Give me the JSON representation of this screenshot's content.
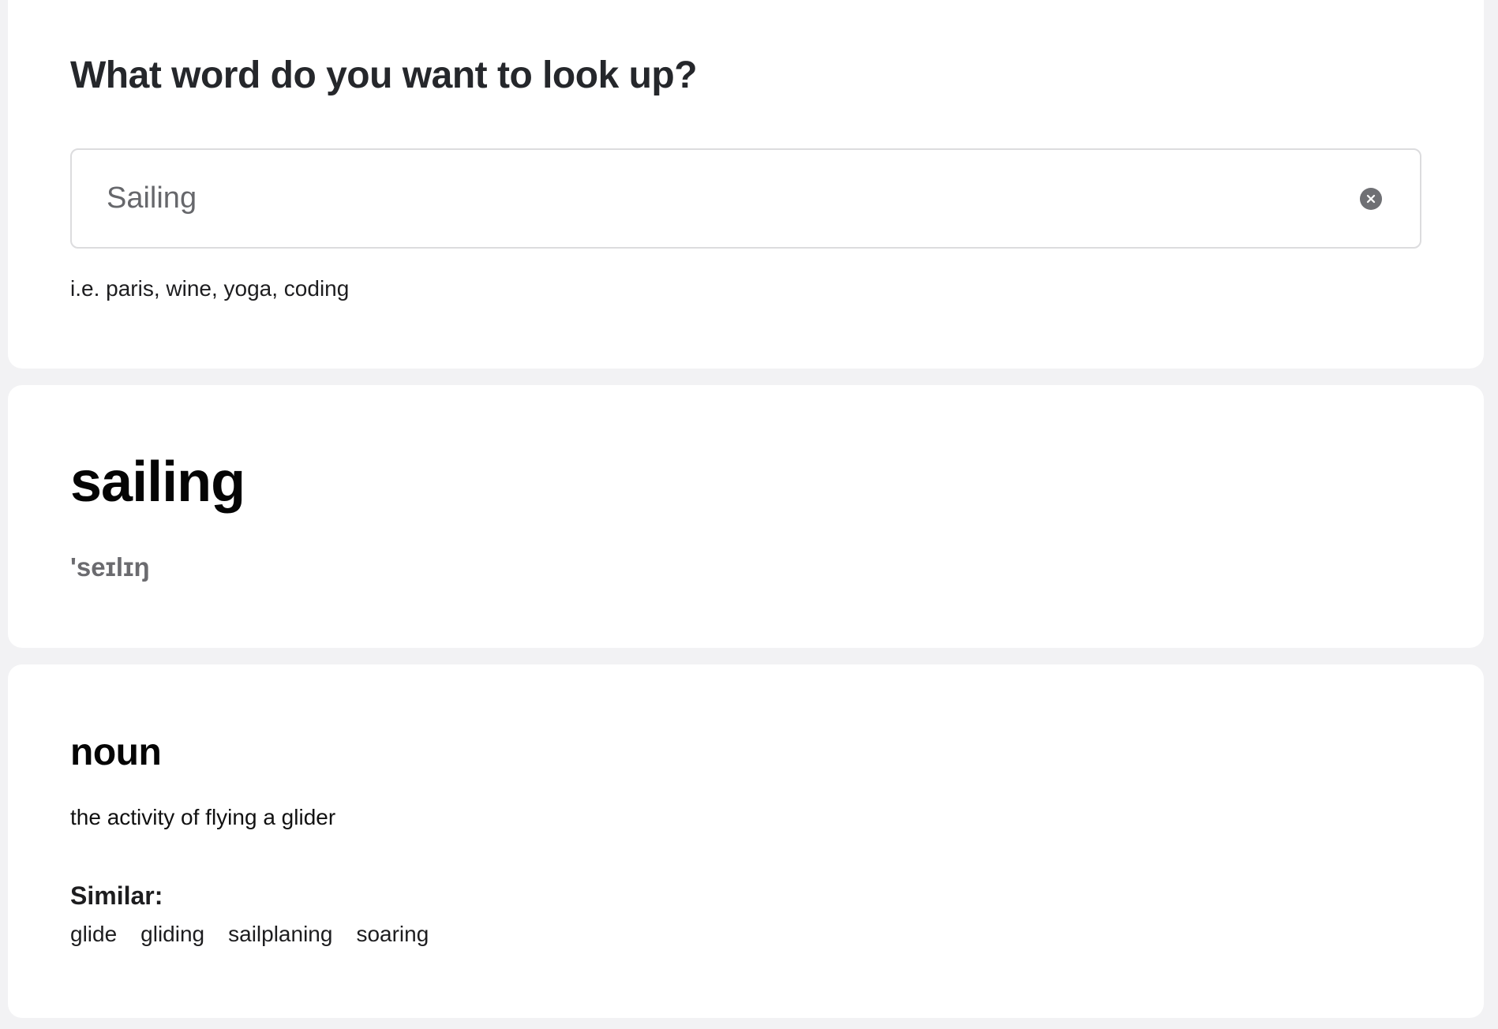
{
  "search": {
    "heading": "What word do you want to look up?",
    "value": "Sailing",
    "hint": "i.e. paris, wine, yoga, coding",
    "clear_icon": "clear-circle-icon"
  },
  "result": {
    "word": "sailing",
    "phonetic": "'seɪlɪŋ"
  },
  "meaning": {
    "part_of_speech": "noun",
    "definition": "the activity of flying a glider",
    "similar_label": "Similar:",
    "similar": [
      "glide",
      "gliding",
      "sailplaning",
      "soaring"
    ]
  }
}
